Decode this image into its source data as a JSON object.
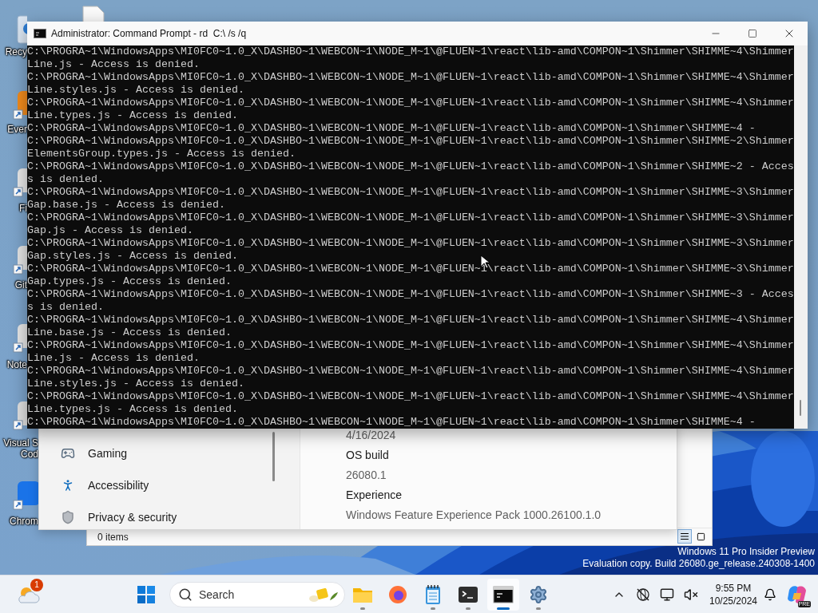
{
  "desktop": {
    "icons": [
      {
        "kind": "bin",
        "label": [
          "Recy"
        ]
      },
      {
        "kind": "file"
      },
      {
        "kind": "app",
        "color": "#f08a1c",
        "label": [
          "Ever"
        ]
      },
      {
        "kind": "app",
        "color": "#e8e8e8",
        "label": [
          "Fi"
        ]
      },
      {
        "kind": "app",
        "color": "#e4e4e4",
        "label": [
          "Git"
        ]
      },
      {
        "kind": "app",
        "color": "#e6e6e6",
        "label": [
          "Note"
        ]
      },
      {
        "kind": "app",
        "color": "#e0e0e0",
        "label": [
          "Visual S",
          "Cod"
        ]
      },
      {
        "kind": "app",
        "color": "#1a73e8",
        "label": [
          "Chrom"
        ]
      }
    ]
  },
  "watermark": [
    "Windows 11 Pro Insider Preview",
    "Evaluation copy. Build 26080.ge_release.240308-1400"
  ],
  "explorer_window": {
    "status": "0 items",
    "views": [
      {
        "kind": "details",
        "selected": true
      },
      {
        "kind": "tiles",
        "selected": false
      }
    ]
  },
  "settings_window": {
    "nav": [
      {
        "kind": "gaming",
        "label": "Gaming"
      },
      {
        "kind": "accessibility",
        "label": "Accessibility"
      },
      {
        "kind": "privacy",
        "label": "Privacy & security"
      }
    ],
    "details": [
      {
        "kind": "value",
        "text": "4/16/2024"
      },
      {
        "kind": "heading",
        "text": "OS build"
      },
      {
        "kind": "value",
        "text": "26080.1"
      },
      {
        "kind": "heading",
        "text": "Experience"
      },
      {
        "kind": "value",
        "text": "Windows Feature Experience Pack 1000.26100.1.0"
      }
    ]
  },
  "cmd_window": {
    "title": "Administrator: Command Prompt - rd  C:\\ /s /q",
    "lines": [
      "C:\\PROGRA~1\\WindowsApps\\MI0FC0~1.0_X\\DASHBO~1\\WEBCON~1\\NODE_M~1\\@FLUEN~1\\react\\lib-amd\\COMPON~1\\Shimmer\\SHIMME~4\\Shimmer",
      "Line.js - Access is denied.",
      "C:\\PROGRA~1\\WindowsApps\\MI0FC0~1.0_X\\DASHBO~1\\WEBCON~1\\NODE_M~1\\@FLUEN~1\\react\\lib-amd\\COMPON~1\\Shimmer\\SHIMME~4\\Shimmer",
      "Line.styles.js - Access is denied.",
      "C:\\PROGRA~1\\WindowsApps\\MI0FC0~1.0_X\\DASHBO~1\\WEBCON~1\\NODE_M~1\\@FLUEN~1\\react\\lib-amd\\COMPON~1\\Shimmer\\SHIMME~4\\Shimmer",
      "Line.types.js - Access is denied.",
      "C:\\PROGRA~1\\WindowsApps\\MI0FC0~1.0_X\\DASHBO~1\\WEBCON~1\\NODE_M~1\\@FLUEN~1\\react\\lib-amd\\COMPON~1\\Shimmer\\SHIMME~4 -",
      "C:\\PROGRA~1\\WindowsApps\\MI0FC0~1.0_X\\DASHBO~1\\WEBCON~1\\NODE_M~1\\@FLUEN~1\\react\\lib-amd\\COMPON~1\\Shimmer\\SHIMME~2\\Shimmer",
      "ElementsGroup.types.js - Access is denied.",
      "C:\\PROGRA~1\\WindowsApps\\MI0FC0~1.0_X\\DASHBO~1\\WEBCON~1\\NODE_M~1\\@FLUEN~1\\react\\lib-amd\\COMPON~1\\Shimmer\\SHIMME~2 - Acces",
      "s is denied.",
      "C:\\PROGRA~1\\WindowsApps\\MI0FC0~1.0_X\\DASHBO~1\\WEBCON~1\\NODE_M~1\\@FLUEN~1\\react\\lib-amd\\COMPON~1\\Shimmer\\SHIMME~3\\Shimmer",
      "Gap.base.js - Access is denied.",
      "C:\\PROGRA~1\\WindowsApps\\MI0FC0~1.0_X\\DASHBO~1\\WEBCON~1\\NODE_M~1\\@FLUEN~1\\react\\lib-amd\\COMPON~1\\Shimmer\\SHIMME~3\\Shimmer",
      "Gap.js - Access is denied.",
      "C:\\PROGRA~1\\WindowsApps\\MI0FC0~1.0_X\\DASHBO~1\\WEBCON~1\\NODE_M~1\\@FLUEN~1\\react\\lib-amd\\COMPON~1\\Shimmer\\SHIMME~3\\Shimmer",
      "Gap.styles.js - Access is denied.",
      "C:\\PROGRA~1\\WindowsApps\\MI0FC0~1.0_X\\DASHBO~1\\WEBCON~1\\NODE_M~1\\@FLUEN~1\\react\\lib-amd\\COMPON~1\\Shimmer\\SHIMME~3\\Shimmer",
      "Gap.types.js - Access is denied.",
      "C:\\PROGRA~1\\WindowsApps\\MI0FC0~1.0_X\\DASHBO~1\\WEBCON~1\\NODE_M~1\\@FLUEN~1\\react\\lib-amd\\COMPON~1\\Shimmer\\SHIMME~3 - Acces",
      "s is denied.",
      "C:\\PROGRA~1\\WindowsApps\\MI0FC0~1.0_X\\DASHBO~1\\WEBCON~1\\NODE_M~1\\@FLUEN~1\\react\\lib-amd\\COMPON~1\\Shimmer\\SHIMME~4\\Shimmer",
      "Line.base.js - Access is denied.",
      "C:\\PROGRA~1\\WindowsApps\\MI0FC0~1.0_X\\DASHBO~1\\WEBCON~1\\NODE_M~1\\@FLUEN~1\\react\\lib-amd\\COMPON~1\\Shimmer\\SHIMME~4\\Shimmer",
      "Line.js - Access is denied.",
      "C:\\PROGRA~1\\WindowsApps\\MI0FC0~1.0_X\\DASHBO~1\\WEBCON~1\\NODE_M~1\\@FLUEN~1\\react\\lib-amd\\COMPON~1\\Shimmer\\SHIMME~4\\Shimmer",
      "Line.styles.js - Access is denied.",
      "C:\\PROGRA~1\\WindowsApps\\MI0FC0~1.0_X\\DASHBO~1\\WEBCON~1\\NODE_M~1\\@FLUEN~1\\react\\lib-amd\\COMPON~1\\Shimmer\\SHIMME~4\\Shimmer",
      "Line.types.js - Access is denied.",
      "C:\\PROGRA~1\\WindowsApps\\MI0FC0~1.0_X\\DASHBO~1\\WEBCON~1\\NODE_M~1\\@FLUEN~1\\react\\lib-amd\\COMPON~1\\Shimmer\\SHIMME~4 -"
    ]
  },
  "taskbar": {
    "weather": {
      "badge": "1"
    },
    "search": {
      "label": "Search"
    },
    "apps": [
      {
        "kind": "explorer",
        "running": true,
        "selected": false
      },
      {
        "kind": "firefox",
        "running": false,
        "selected": false
      },
      {
        "kind": "notepad",
        "running": true,
        "selected": false
      },
      {
        "kind": "terminal",
        "running": true,
        "selected": false
      },
      {
        "kind": "cmd",
        "running": true,
        "selected": true
      },
      {
        "kind": "settings",
        "running": true,
        "selected": false
      }
    ],
    "tray": [
      {
        "kind": "chevron"
      },
      {
        "kind": "network"
      },
      {
        "kind": "display"
      },
      {
        "kind": "volume"
      }
    ],
    "clock": {
      "time": "9:55 PM",
      "date": "10/25/2024"
    },
    "copilot": {
      "badge": "PRE"
    }
  }
}
